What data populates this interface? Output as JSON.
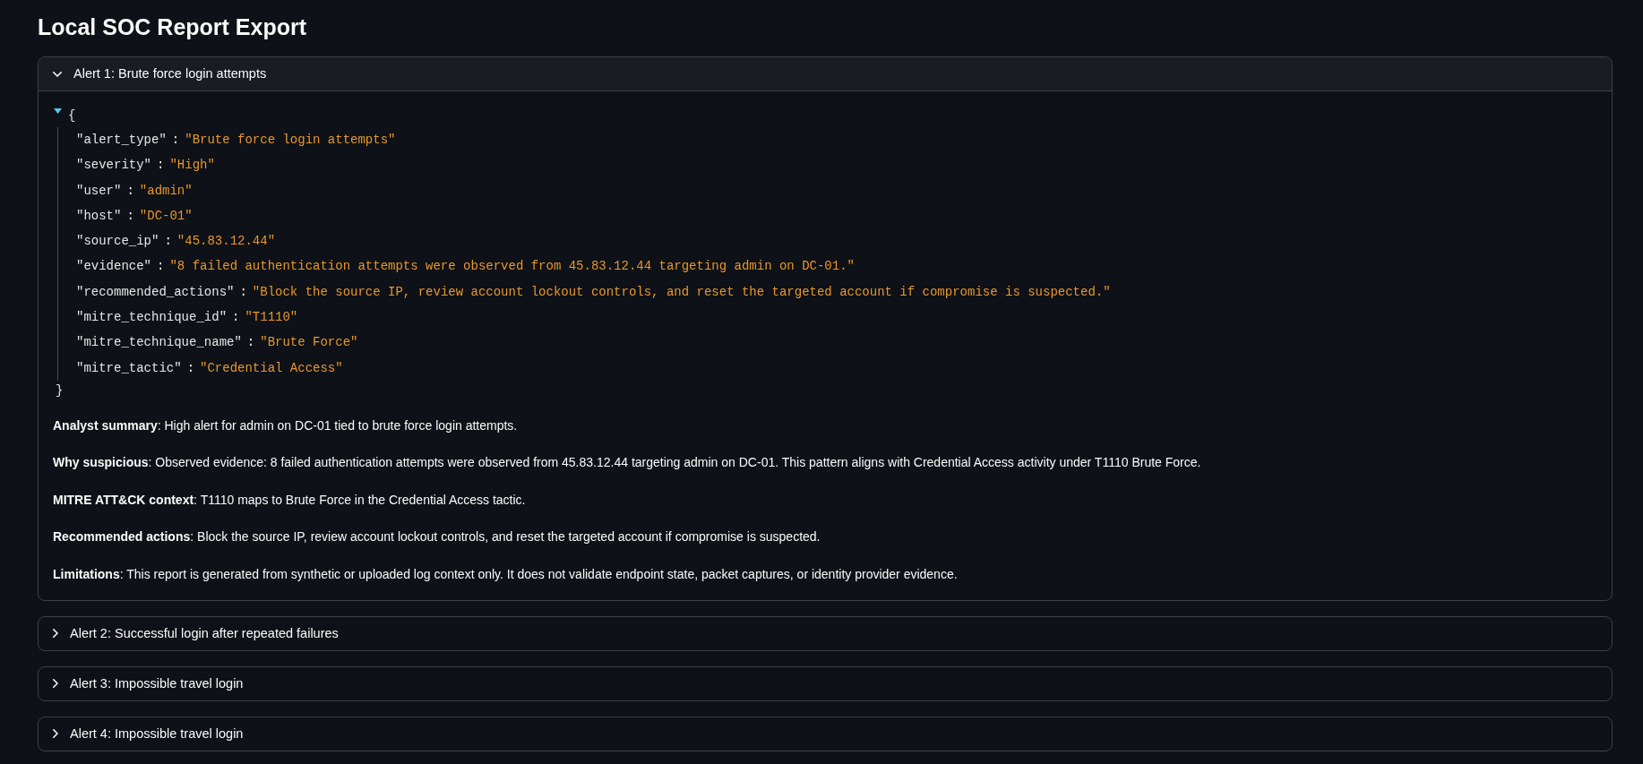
{
  "page_title": "Local SOC Report Export",
  "alerts": [
    {
      "label": "Alert 1: Brute force login attempts",
      "expanded": true,
      "json_view": {
        "expanded": true,
        "open_brace": "{",
        "close_brace": "}",
        "entries": [
          {
            "key": "\"alert_type\"",
            "separator": ":",
            "value": "\"Brute force login attempts\""
          },
          {
            "key": "\"severity\"",
            "separator": ":",
            "value": "\"High\""
          },
          {
            "key": "\"user\"",
            "separator": ":",
            "value": "\"admin\""
          },
          {
            "key": "\"host\"",
            "separator": ":",
            "value": "\"DC-01\""
          },
          {
            "key": "\"source_ip\"",
            "separator": ":",
            "value": "\"45.83.12.44\""
          },
          {
            "key": "\"evidence\"",
            "separator": ":",
            "value": "\"8 failed authentication attempts were observed from 45.83.12.44 targeting admin on DC-01.\""
          },
          {
            "key": "\"recommended_actions\"",
            "separator": ":",
            "value": "\"Block the source IP, review account lockout controls, and reset the targeted account if compromise is suspected.\""
          },
          {
            "key": "\"mitre_technique_id\"",
            "separator": ":",
            "value": "\"T1110\""
          },
          {
            "key": "\"mitre_technique_name\"",
            "separator": ":",
            "value": "\"Brute Force\""
          },
          {
            "key": "\"mitre_tactic\"",
            "separator": ":",
            "value": "\"Credential Access\""
          }
        ]
      },
      "paragraphs": [
        "**Analyst summary**: High alert for admin on DC-01 tied to brute force login attempts.",
        "**Why suspicious**: Observed evidence: 8 failed authentication attempts were observed from 45.83.12.44 targeting admin on DC-01. This pattern aligns with Credential Access activity under T1110 Brute Force.",
        "**MITRE ATT&CK context**: T1110 maps to Brute Force in the Credential Access tactic.",
        "**Recommended actions**: Block the source IP, review account lockout controls, and reset the targeted account if compromise is suspected.",
        "**Limitations**: This report is generated from synthetic or uploaded log context only. It does not validate endpoint state, packet captures, or identity provider evidence."
      ]
    },
    {
      "label": "Alert 2: Successful login after repeated failures",
      "expanded": false
    },
    {
      "label": "Alert 3: Impossible travel login",
      "expanded": false
    },
    {
      "label": "Alert 4: Impossible travel login",
      "expanded": false
    }
  ]
}
